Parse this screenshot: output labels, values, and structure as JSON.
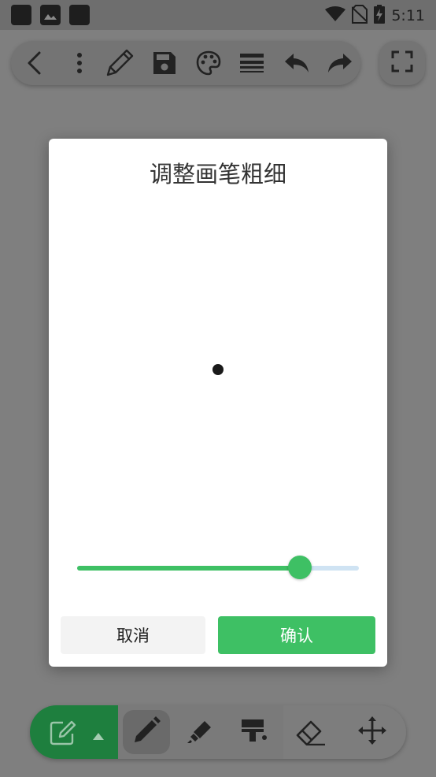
{
  "status_bar": {
    "time": "5:11",
    "icons": [
      "notification-icon",
      "image-icon",
      "notification-icon",
      "wifi-icon",
      "no-sim-icon",
      "battery-charging-icon"
    ]
  },
  "top_toolbar": {
    "icons": [
      "back-icon",
      "more-vertical-icon",
      "pencil-icon",
      "save-icon",
      "palette-icon",
      "line-weight-icon",
      "undo-icon",
      "redo-icon"
    ],
    "fullscreen_icon": "fullscreen-icon"
  },
  "dialog": {
    "title": "调整画笔粗细",
    "slider": {
      "value": 0.79
    },
    "cancel_label": "取消",
    "confirm_label": "确认"
  },
  "bottom_toolbar": {
    "mode_icon": "edit-note-icon",
    "tools": [
      "pen-icon",
      "highlighter-icon",
      "paint-roller-icon",
      "eraser-icon",
      "move-icon"
    ],
    "active_tool": "pen-icon"
  },
  "colors": {
    "accent": "#3ec064",
    "mode_bg": "#1e7f3e",
    "slider_track": "#cfe3f3"
  }
}
